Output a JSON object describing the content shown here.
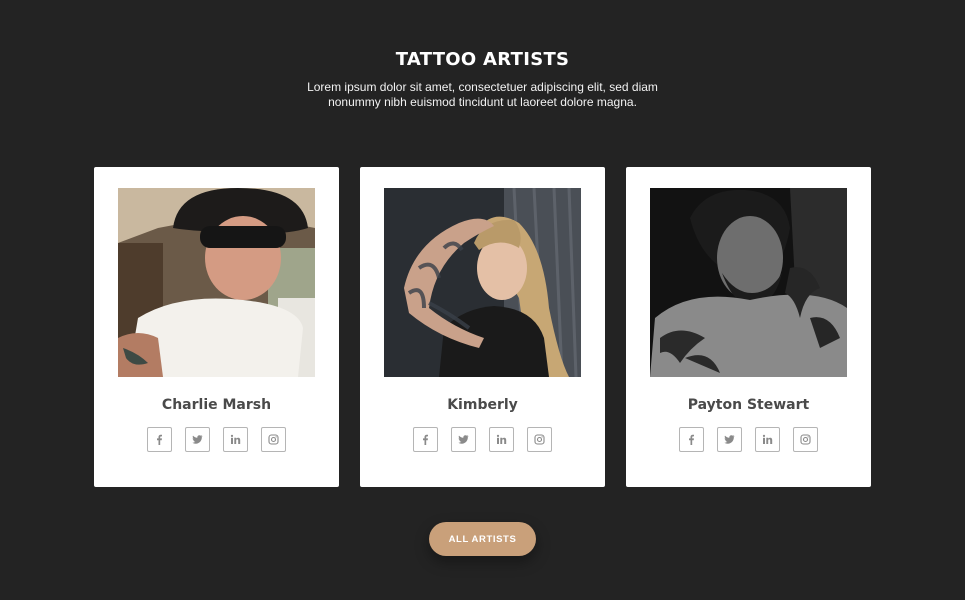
{
  "section": {
    "title": "TATTOO ARTISTS",
    "description": "Lorem ipsum dolor sit amet, consectetuer adipiscing elit, sed diam nonummy nibh euismod tincidunt ut laoreet dolore magna."
  },
  "artists": [
    {
      "name": "Charlie Marsh"
    },
    {
      "name": "Kimberly"
    },
    {
      "name": "Payton Stewart"
    }
  ],
  "social_icons": [
    "facebook-icon",
    "twitter-icon",
    "linkedin-icon",
    "instagram-icon"
  ],
  "button": {
    "label": "ALL ARTISTS"
  },
  "colors": {
    "background": "#232323",
    "card": "#ffffff",
    "accent": "#c9a07a",
    "name_text": "#4a4a4a",
    "icon_border": "#b5b5b5"
  }
}
